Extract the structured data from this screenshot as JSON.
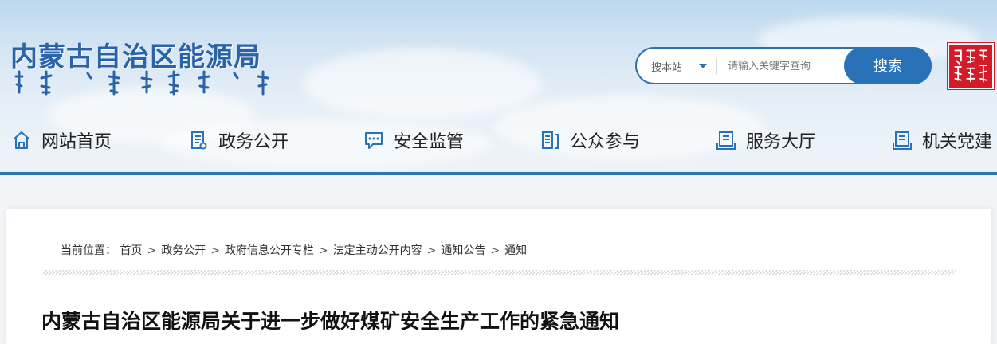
{
  "header": {
    "site_title": "内蒙古自治区能源局"
  },
  "search": {
    "scope_label": "搜本站",
    "placeholder": "请输入关键字查询",
    "button_label": "搜索"
  },
  "nav": [
    {
      "label": "网站首页",
      "icon": "home-icon"
    },
    {
      "label": "政务公开",
      "icon": "document-list-icon"
    },
    {
      "label": "安全监管",
      "icon": "chat-bubble-icon"
    },
    {
      "label": "公众参与",
      "icon": "notes-icon"
    },
    {
      "label": "服务大厅",
      "icon": "inbox-icon"
    },
    {
      "label": "机关党建",
      "icon": "inbox-icon"
    }
  ],
  "breadcrumb": {
    "prefix": "当前位置：",
    "items": [
      "首页",
      "政务公开",
      "政府信息公开专栏",
      "法定主动公开内容",
      "通知公告",
      "通知"
    ],
    "separator": ">"
  },
  "article": {
    "title": "内蒙古自治区能源局关于进一步做好煤矿安全生产工作的紧急通知"
  },
  "colors": {
    "accent": "#2a72b8",
    "title_blue": "#2b63a8",
    "seal_red": "#d31b2a",
    "header_rule": "#2878b5"
  }
}
